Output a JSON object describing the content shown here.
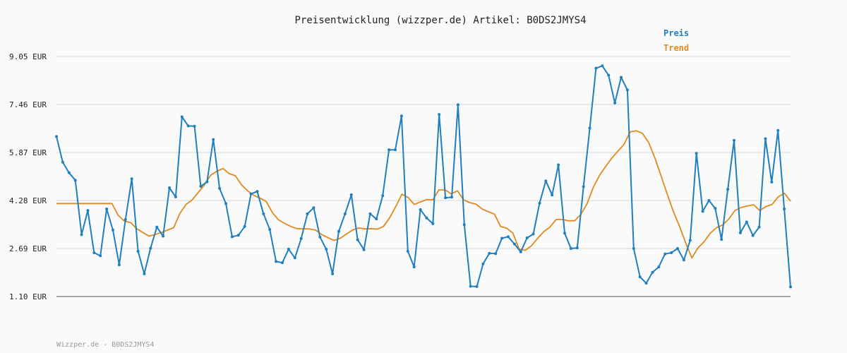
{
  "chart_data": {
    "type": "line",
    "title": "Preisentwicklung (wizzper.de) Artikel: B0DS2JMYS4",
    "footer": "Wizzper.de - B0DS2JMYS4",
    "xlabel": "",
    "ylabel": "",
    "ylim": [
      1.1,
      9.05
    ],
    "y_ticks": [
      "9.05 EUR",
      "7.46 EUR",
      "5.87 EUR",
      "4.28 EUR",
      "2.69 EUR",
      "1.10 EUR"
    ],
    "y_tick_values": [
      9.05,
      7.46,
      5.87,
      4.28,
      2.69,
      1.1
    ],
    "grid": true,
    "legend_position": "top-right",
    "series": [
      {
        "name": "Preis",
        "color": "#1f7fbf",
        "values": [
          6.4,
          5.55,
          5.2,
          4.95,
          3.15,
          3.95,
          2.55,
          2.45,
          4.0,
          3.3,
          2.15,
          3.65,
          5.0,
          2.6,
          1.85,
          2.7,
          3.4,
          3.1,
          4.7,
          4.4,
          7.05,
          6.75,
          6.74,
          4.75,
          4.9,
          6.3,
          4.68,
          4.18,
          3.08,
          3.13,
          3.42,
          4.5,
          4.58,
          3.84,
          3.32,
          2.26,
          2.22,
          2.67,
          2.38,
          3.02,
          3.84,
          4.04,
          3.07,
          2.67,
          1.85,
          3.26,
          3.84,
          4.47,
          2.98,
          2.65,
          3.84,
          3.67,
          4.44,
          5.96,
          5.96,
          7.08,
          2.6,
          2.08,
          3.98,
          3.7,
          3.51,
          7.13,
          4.37,
          4.39,
          7.45,
          3.48,
          1.44,
          1.43,
          2.18,
          2.53,
          2.52,
          3.03,
          3.08,
          2.84,
          2.58,
          3.04,
          3.17,
          4.19,
          4.93,
          4.46,
          5.46,
          3.2,
          2.69,
          2.71,
          4.74,
          6.68,
          8.66,
          8.74,
          8.43,
          7.51,
          8.36,
          7.94,
          2.69,
          1.75,
          1.54,
          1.9,
          2.08,
          2.51,
          2.55,
          2.69,
          2.31,
          2.96,
          5.84,
          3.92,
          4.28,
          4.02,
          2.99,
          4.65,
          6.27,
          3.21,
          3.57,
          3.12,
          3.4,
          6.33,
          4.89,
          6.6,
          4.0,
          1.42
        ]
      },
      {
        "name": "Trend",
        "color": "#e08a1e",
        "values": [
          4.18,
          4.18,
          4.18,
          4.18,
          4.18,
          4.18,
          4.18,
          4.18,
          4.18,
          4.18,
          3.79,
          3.6,
          3.55,
          3.35,
          3.22,
          3.1,
          3.15,
          3.22,
          3.3,
          3.38,
          3.85,
          4.15,
          4.3,
          4.55,
          4.8,
          5.12,
          5.25,
          5.34,
          5.17,
          5.1,
          4.8,
          4.6,
          4.45,
          4.36,
          4.25,
          3.88,
          3.64,
          3.52,
          3.42,
          3.35,
          3.34,
          3.34,
          3.3,
          3.15,
          3.05,
          2.96,
          3.03,
          3.17,
          3.3,
          3.37,
          3.34,
          3.35,
          3.33,
          3.42,
          3.7,
          4.08,
          4.49,
          4.38,
          4.15,
          4.23,
          4.31,
          4.3,
          4.63,
          4.63,
          4.5,
          4.6,
          4.3,
          4.21,
          4.16,
          4.0,
          3.91,
          3.83,
          3.42,
          3.36,
          3.2,
          2.67,
          2.63,
          2.78,
          3.03,
          3.25,
          3.4,
          3.65,
          3.65,
          3.61,
          3.61,
          3.82,
          4.16,
          4.7,
          5.1,
          5.4,
          5.68,
          5.91,
          6.14,
          6.55,
          6.59,
          6.5,
          6.2,
          5.7,
          5.1,
          4.5,
          3.92,
          3.43,
          2.88,
          2.38,
          2.71,
          2.92,
          3.2,
          3.38,
          3.47,
          3.67,
          3.95,
          4.05,
          4.1,
          4.14,
          3.95,
          4.08,
          4.15,
          4.4,
          4.52,
          4.26
        ]
      }
    ]
  }
}
